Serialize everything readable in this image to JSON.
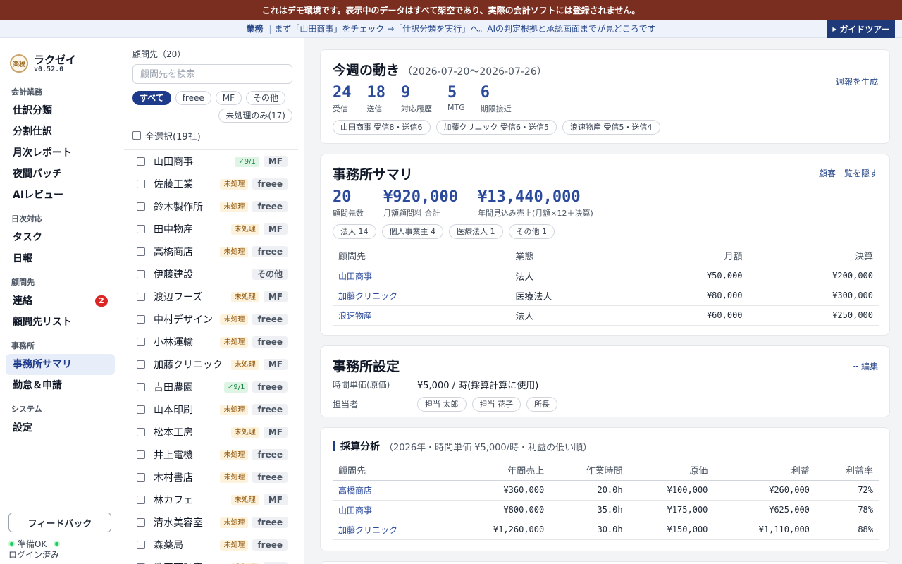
{
  "banner": "これはデモ環境です。表示中のデータはすべて架空であり、実際の会計ソフトには登録されません。",
  "guide": {
    "tag": "業務",
    "sep": "|",
    "text": "まず「山田商事」をチェック →「仕訳分類を実行」へ。AIの判定根拠と承認画面までが見どころです",
    "button": "ガイドツアー"
  },
  "brand": {
    "logo": "楽税",
    "name": "ラクゼイ",
    "version": "v0.52.0"
  },
  "nav": {
    "sections": [
      {
        "title": "会計業務",
        "items": [
          {
            "label": "仕訳分類"
          },
          {
            "label": "分割仕訳"
          },
          {
            "label": "月次レポート"
          },
          {
            "label": "夜間バッチ"
          },
          {
            "label": "AIレビュー"
          }
        ]
      },
      {
        "title": "日次対応",
        "items": [
          {
            "label": "タスク"
          },
          {
            "label": "日報"
          }
        ]
      },
      {
        "title": "顧問先",
        "items": [
          {
            "label": "連絡",
            "badge": "2"
          },
          {
            "label": "顧問先リスト"
          }
        ]
      },
      {
        "title": "事務所",
        "items": [
          {
            "label": "事務所サマリ"
          },
          {
            "label": "勤怠＆申請"
          }
        ]
      },
      {
        "title": "システム",
        "items": [
          {
            "label": "設定"
          }
        ]
      }
    ]
  },
  "footer": {
    "feedback": "フィードバック",
    "ready": "準備OK",
    "login": "ログイン済み"
  },
  "clients": {
    "title": "顧問先（20）",
    "search_placeholder": "顧問先を検索",
    "filters": [
      "すべて",
      "freee",
      "MF",
      "その他"
    ],
    "unprocessed_filter": "未処理のみ(17)",
    "select_all": "全選択(19社)",
    "rows": [
      {
        "name": "山田商事",
        "status": "✓9/1",
        "done": true,
        "software": "MF"
      },
      {
        "name": "佐藤工業",
        "status": "未処理",
        "done": false,
        "software": "freee"
      },
      {
        "name": "鈴木製作所",
        "status": "未処理",
        "done": false,
        "software": "freee"
      },
      {
        "name": "田中物産",
        "status": "未処理",
        "done": false,
        "software": "MF"
      },
      {
        "name": "高橋商店",
        "status": "未処理",
        "done": false,
        "software": "freee"
      },
      {
        "name": "伊藤建設",
        "status": "",
        "done": false,
        "software": "その他"
      },
      {
        "name": "渡辺フーズ",
        "status": "未処理",
        "done": false,
        "software": "MF"
      },
      {
        "name": "中村デザイン",
        "status": "未処理",
        "done": false,
        "software": "freee"
      },
      {
        "name": "小林運輸",
        "status": "未処理",
        "done": false,
        "software": "freee"
      },
      {
        "name": "加藤クリニック",
        "status": "未処理",
        "done": false,
        "software": "MF"
      },
      {
        "name": "吉田農園",
        "status": "✓9/1",
        "done": true,
        "software": "freee"
      },
      {
        "name": "山本印刷",
        "status": "未処理",
        "done": false,
        "software": "freee"
      },
      {
        "name": "松本工房",
        "status": "未処理",
        "done": false,
        "software": "MF"
      },
      {
        "name": "井上電機",
        "status": "未処理",
        "done": false,
        "software": "freee"
      },
      {
        "name": "木村書店",
        "status": "未処理",
        "done": false,
        "software": "freee"
      },
      {
        "name": "林カフェ",
        "status": "未処理",
        "done": false,
        "software": "MF"
      },
      {
        "name": "清水美容室",
        "status": "未処理",
        "done": false,
        "software": "freee"
      },
      {
        "name": "森薬局",
        "status": "未処理",
        "done": false,
        "software": "freee"
      },
      {
        "name": "池田不動産",
        "status": "未処理",
        "done": false,
        "software": "MF"
      }
    ]
  },
  "weekly": {
    "title": "今週の動き",
    "range": "（2026-07-20〜2026-07-26）",
    "link": "週報を生成",
    "stats": [
      {
        "num": "24",
        "label": "受信"
      },
      {
        "num": "18",
        "label": "送信"
      },
      {
        "num": "9",
        "label": "対応履歴"
      },
      {
        "num": "5",
        "label": "MTG"
      },
      {
        "num": "6",
        "label": "期限接近"
      }
    ],
    "pills": [
      "山田商事 受信8・送信6",
      "加藤クリニック 受信6・送信5",
      "浪速物産 受信5・送信4"
    ]
  },
  "summary": {
    "title": "事務所サマリ",
    "link": "顧客一覧を隠す",
    "stats": [
      {
        "num": "20",
        "label": "顧問先数"
      },
      {
        "num": "¥920,000",
        "label": "月額顧問料 合計"
      },
      {
        "num": "¥13,440,000",
        "label": "年間見込み売上(月額×12＋決算)"
      }
    ],
    "pills": [
      "法人 14",
      "個人事業主 4",
      "医療法人 1",
      "その他 1"
    ],
    "columns": [
      "顧問先",
      "業態",
      "月額",
      "決算"
    ],
    "rows": [
      [
        "山田商事",
        "法人",
        "¥50,000",
        "¥200,000"
      ],
      [
        "加藤クリニック",
        "医療法人",
        "¥80,000",
        "¥300,000"
      ],
      [
        "浪速物産",
        "法人",
        "¥60,000",
        "¥250,000"
      ]
    ]
  },
  "settings": {
    "title": "事務所設定",
    "edit": "編集",
    "rate_label": "時間単価(原価)",
    "rate_value": "¥5,000 / 時(採算計算に使用)",
    "staff_label": "担当者",
    "staff": [
      "担当 太郎",
      "担当 花子",
      "所長"
    ]
  },
  "profit": {
    "title": "採算分析",
    "sub": "（2026年・時間単価 ¥5,000/時・利益の低い順）",
    "columns": [
      "顧問先",
      "年間売上",
      "作業時間",
      "原価",
      "利益",
      "利益率"
    ],
    "rows": [
      [
        "高橋商店",
        "¥360,000",
        "20.0h",
        "¥100,000",
        "¥260,000",
        "72%"
      ],
      [
        "山田商事",
        "¥800,000",
        "35.0h",
        "¥175,000",
        "¥625,000",
        "78%"
      ],
      [
        "加藤クリニック",
        "¥1,260,000",
        "30.0h",
        "¥150,000",
        "¥1,110,000",
        "88%"
      ]
    ]
  }
}
